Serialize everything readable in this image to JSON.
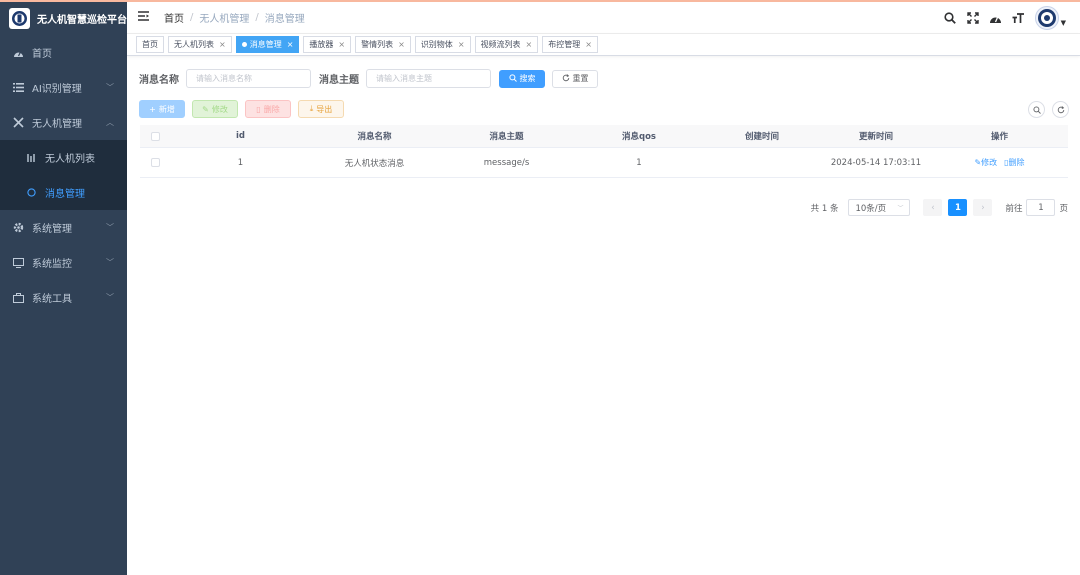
{
  "app": {
    "title": "无人机智慧巡检平台"
  },
  "sidebar": {
    "items": [
      {
        "label": "首页",
        "icon": "dashboard-icon"
      },
      {
        "label": "AI识别管理",
        "icon": "list-icon"
      },
      {
        "label": "无人机管理",
        "icon": "tools-icon",
        "expanded": true
      },
      {
        "label": "无人机列表",
        "icon": "drone-icon"
      },
      {
        "label": "消息管理",
        "icon": "message-icon",
        "active": true
      },
      {
        "label": "系统管理",
        "icon": "gear-icon"
      },
      {
        "label": "系统监控",
        "icon": "monitor-icon"
      },
      {
        "label": "系统工具",
        "icon": "toolbox-icon"
      }
    ]
  },
  "breadcrumb": [
    "首页",
    "无人机管理",
    "消息管理"
  ],
  "tags": [
    {
      "label": "首页",
      "closable": false
    },
    {
      "label": "无人机列表",
      "closable": true
    },
    {
      "label": "消息管理",
      "closable": true,
      "active": true
    },
    {
      "label": "播放器",
      "closable": true
    },
    {
      "label": "警情列表",
      "closable": true
    },
    {
      "label": "识别物体",
      "closable": true
    },
    {
      "label": "视频流列表",
      "closable": true
    },
    {
      "label": "布控管理",
      "closable": true
    }
  ],
  "search": {
    "name_label": "消息名称",
    "name_placeholder": "请输入消息名称",
    "topic_label": "消息主题",
    "topic_placeholder": "请输入消息主题",
    "search_btn": "搜索",
    "reset_btn": "重置"
  },
  "toolbar": {
    "add": "新增",
    "edit": "修改",
    "delete": "删除",
    "export": "导出"
  },
  "table": {
    "headers": [
      "id",
      "消息名称",
      "消息主题",
      "消息qos",
      "创建时间",
      "更新时间",
      "操作"
    ],
    "rows": [
      {
        "id": "1",
        "name": "无人机状态消息",
        "topic": "message/s",
        "qos": "1",
        "created": "",
        "updated": "2024-05-14 17:03:11",
        "edit": "修改",
        "delete": "删除"
      }
    ]
  },
  "pagination": {
    "total": "共 1 条",
    "page_size": "10条/页",
    "current": "1",
    "goto_label": "前往",
    "goto_value": "1",
    "page_unit": "页"
  },
  "colors": {
    "sidebar_bg": "#304156",
    "submenu_bg": "#1f2d3d",
    "primary": "#409eff",
    "active_tag": "#42a5f5"
  }
}
